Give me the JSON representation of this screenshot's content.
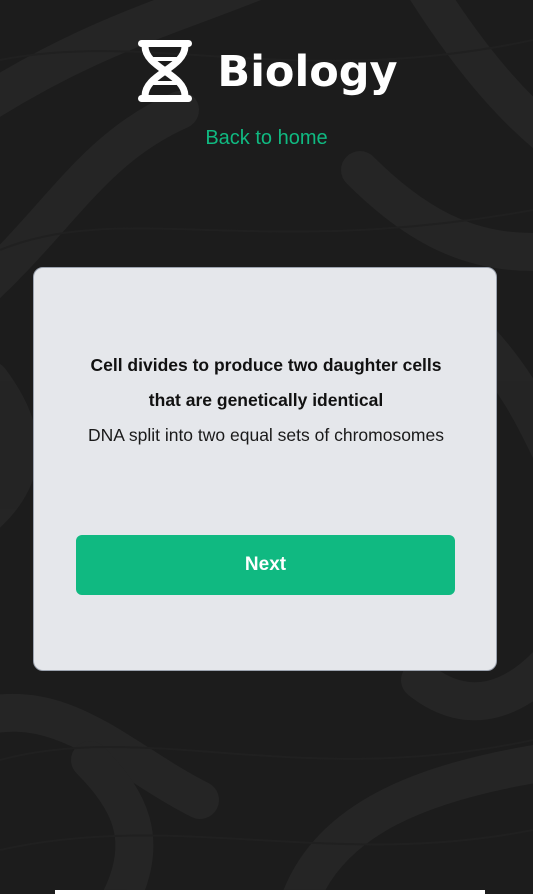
{
  "header": {
    "title": "Biology",
    "logo_icon": "dna-icon"
  },
  "nav": {
    "back_label": "Back to home"
  },
  "card": {
    "question": "Cell divides to produce two daughter cells that are genetically identical",
    "answer": "DNA split into two equal sets of chromosomes",
    "next_label": "Next"
  },
  "colors": {
    "background": "#1c1c1c",
    "accent": "#10b981",
    "card": "#e5e7eb"
  }
}
